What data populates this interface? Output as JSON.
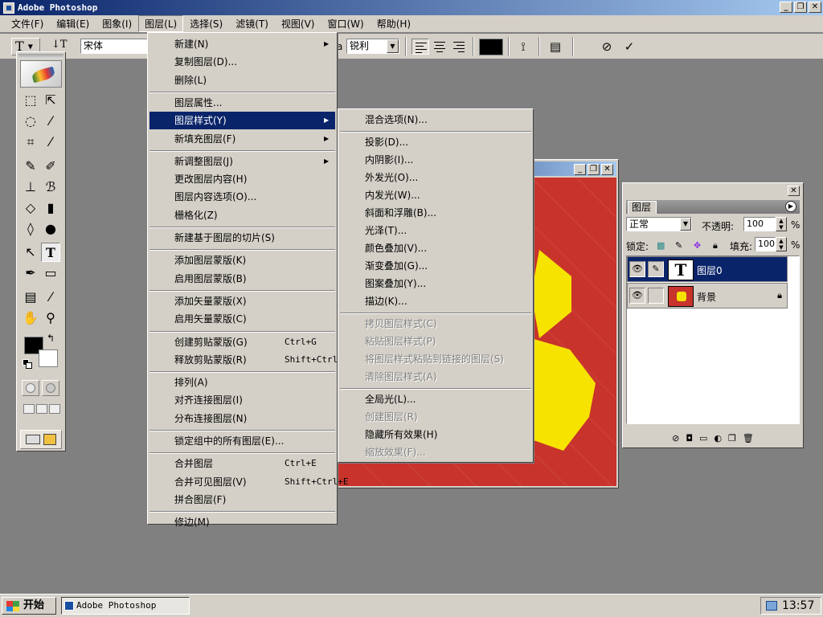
{
  "window": {
    "title": "Adobe Photoshop",
    "min": "_",
    "restore": "❐",
    "close": "✕"
  },
  "menubar": [
    "文件(F)",
    "编辑(E)",
    "图象(I)",
    "图层(L)",
    "选择(S)",
    "滤镜(T)",
    "视图(V)",
    "窗口(W)",
    "帮助(H)"
  ],
  "options": {
    "tool": "T",
    "orient": "↓T",
    "font": "宋体",
    "aa_label": "a",
    "aa": "锐利",
    "commit": "✓",
    "cancel": "⃠"
  },
  "layer_menu": {
    "items": [
      {
        "label": "新建(N)",
        "sub": true
      },
      {
        "label": "复制图层(D)..."
      },
      {
        "label": "删除(L)"
      },
      {
        "sep": true
      },
      {
        "label": "图层属性..."
      },
      {
        "label": "图层样式(Y)",
        "sub": true,
        "hl": true
      },
      {
        "label": "新填充图层(F)",
        "sub": true
      },
      {
        "sep": true
      },
      {
        "label": "新调整图层(J)",
        "sub": true
      },
      {
        "label": "更改图层内容(H)"
      },
      {
        "label": "图层内容选项(O)..."
      },
      {
        "label": "栅格化(Z)"
      },
      {
        "sep": true
      },
      {
        "label": "新建基于图层的切片(S)"
      },
      {
        "sep": true
      },
      {
        "label": "添加图层蒙版(K)"
      },
      {
        "label": "启用图层蒙版(B)"
      },
      {
        "sep": true
      },
      {
        "label": "添加矢量蒙版(X)"
      },
      {
        "label": "启用矢量蒙版(C)"
      },
      {
        "sep": true
      },
      {
        "label": "创建剪贴蒙版(G)",
        "shortcut": "Ctrl+G"
      },
      {
        "label": "释放剪贴蒙版(R)",
        "shortcut": "Shift+Ctrl+G"
      },
      {
        "sep": true
      },
      {
        "label": "排列(A)"
      },
      {
        "label": "对齐连接图层(I)"
      },
      {
        "label": "分布连接图层(N)"
      },
      {
        "sep": true
      },
      {
        "label": "锁定组中的所有图层(E)..."
      },
      {
        "sep": true
      },
      {
        "label": "合并图层",
        "shortcut": "Ctrl+E"
      },
      {
        "label": "合并可见图层(V)",
        "shortcut": "Shift+Ctrl+E"
      },
      {
        "label": "拼合图层(F)"
      },
      {
        "sep": true
      },
      {
        "label": "修边(M)"
      }
    ]
  },
  "style_menu": {
    "items": [
      {
        "label": "混合选项(N)..."
      },
      {
        "sep": true
      },
      {
        "label": "投影(D)..."
      },
      {
        "label": "内阴影(I)..."
      },
      {
        "label": "外发光(O)..."
      },
      {
        "label": "内发光(W)..."
      },
      {
        "label": "斜面和浮雕(B)..."
      },
      {
        "label": "光泽(T)..."
      },
      {
        "label": "颜色叠加(V)..."
      },
      {
        "label": "渐变叠加(G)..."
      },
      {
        "label": "图案叠加(Y)..."
      },
      {
        "label": "描边(K)..."
      },
      {
        "sep": true
      },
      {
        "label": "拷贝图层样式(C)",
        "dis": true
      },
      {
        "label": "粘贴图层样式(P)",
        "dis": true
      },
      {
        "label": "将图层样式粘贴到链接的图层(S)",
        "dis": true
      },
      {
        "label": "清除图层样式(A)",
        "dis": true
      },
      {
        "sep": true
      },
      {
        "label": "全局光(L)..."
      },
      {
        "label": "创建图层(R)",
        "dis": true
      },
      {
        "label": "隐藏所有效果(H)"
      },
      {
        "label": "缩放效果(F)...",
        "dis": true
      }
    ]
  },
  "layers_panel": {
    "tab": "图层",
    "mode": "正常",
    "opacity_label": "不透明:",
    "opacity": "100",
    "lock_label": "锁定:",
    "fill_label": "填充:",
    "fill": "100",
    "pct": "%",
    "layers": [
      {
        "name": "图层0",
        "thumb": "T",
        "selected": true
      },
      {
        "name": "背景",
        "locked": true
      }
    ]
  },
  "taskbar": {
    "start": "开始",
    "task": "Adobe Photoshop",
    "clock": "13:57"
  },
  "colors": {
    "titlebar": "#0a246a",
    "canvas_red": "#c8332c",
    "art_yellow": "#f7e300",
    "menu_hl": "#0a246a"
  }
}
